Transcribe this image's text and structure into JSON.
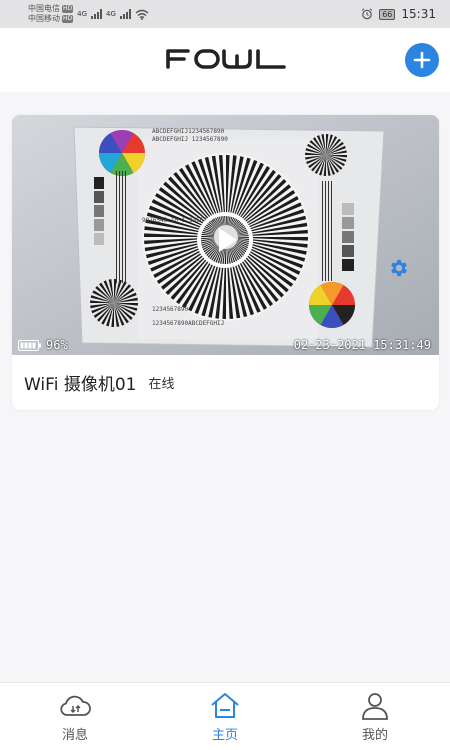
{
  "status_bar": {
    "carrier_1": "中国电信",
    "carrier_2": "中国移动",
    "hd_badge": "HD",
    "network_type": "4G",
    "battery_level": "66",
    "time": "15:31"
  },
  "header": {
    "logo_text": "FOWL",
    "add_icon": "plus-icon"
  },
  "camera_card": {
    "battery_percent": "96%",
    "timestamp": "02-23-2021 15:31:49",
    "name": "WiFi 摄像机01",
    "status": "在线",
    "play_icon": "play-icon",
    "settings_icon": "gear-icon"
  },
  "nav": {
    "items": [
      {
        "label": "消息",
        "icon": "cloud-icon",
        "active": false
      },
      {
        "label": "主页",
        "icon": "home-icon",
        "active": true
      },
      {
        "label": "我的",
        "icon": "user-icon",
        "active": false
      }
    ]
  },
  "colors": {
    "accent": "#2a84e0",
    "background": "#f6f6f8",
    "status_bar": "#e3e3e5"
  }
}
